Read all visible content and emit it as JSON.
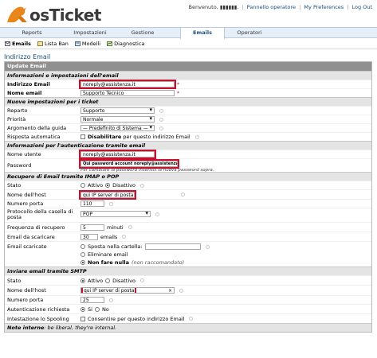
{
  "brand": {
    "name": "osTicket",
    "accent": "#e8861a",
    "link_color": "#184e81"
  },
  "toplinks": {
    "welcome": "Benvenuto, ",
    "user": "▮▮▮▮▮▮.",
    "panel": "Pannello operatore",
    "prefs": "My Preferences",
    "logout": "Log Out"
  },
  "tabs": [
    "Reports",
    "Impostazioni",
    "Gestione",
    "Emails",
    "Operatori"
  ],
  "subnav": [
    {
      "label": "Emails",
      "icon": "email-icon"
    },
    {
      "label": "Lista Ban",
      "icon": "ban-list-icon"
    },
    {
      "label": "Modelli",
      "icon": "template-icon"
    },
    {
      "label": "Diagnostica",
      "icon": "diagnostic-icon"
    }
  ],
  "page_title": "Indirizzo Email",
  "form": {
    "header": "Update Email",
    "s1": {
      "title": "Informazioni e impostazioni dell'email",
      "email_label": "Indirizzo Email",
      "email_value": "noreply@assistenza.it",
      "name_label": "Nome email",
      "name_value": "Supporto Tecnico",
      "req": "*"
    },
    "s2": {
      "title": "Nuove impostazioni per i ticket",
      "dept_label": "Reparto",
      "dept_value": "Supporto",
      "priority_label": "Priorità",
      "priority_value": "Normale",
      "topic_label": "Argomento della guida",
      "topic_value": "— Predefinito di Sistema —",
      "auto_label": "Risposta automatica",
      "auto_bold": "Disabilitare",
      "auto_rest": " per questo indirizzo Email"
    },
    "s3": {
      "title": "Informazioni per l'autenticazione tramite email",
      "user_label": "Nome utente",
      "user_value": "noreply@assistenza.it",
      "pass_label": "Password",
      "pass_value": "Qui password account noreply@assistenza.it",
      "pass_note": "Per cambiare la password inserisci la nuova password sopra."
    },
    "s4": {
      "title": "Recupero di Email tramite IMAP o POP",
      "status_label": "Stato",
      "status_on": "Attivo",
      "status_off": "Disattivo",
      "host_label": "Nome dell'host",
      "host_value": "qui IP server di posta",
      "port_label": "Numero porta",
      "port_value": "110",
      "proto_label": "Protocollo della casella di posta",
      "proto_value": "POP",
      "freq_label": "Frequenza di recupero",
      "freq_value": "5",
      "freq_unit": "minuti",
      "fetch_label": "Email da scaricare",
      "fetch_value": "30",
      "fetch_unit": "emails",
      "downloaded_label": "Email scaricate",
      "opt_move": "Sposta nella cartella:",
      "opt_delete": "Eliminare email",
      "opt_nothing": "Non fare nulla",
      "opt_nothing_note": "(non raccomandato)"
    },
    "s5": {
      "title": "inviare email tramite SMTP",
      "status_label": "Stato",
      "status_on": "Attivo",
      "status_off": "Disattivo",
      "host_label": "Nome dell'host",
      "host_value": "qui IP server di posta",
      "port_label": "Numero porta",
      "port_value": "25",
      "auth_label": "Autenticazione richiesta",
      "auth_yes": "Si",
      "auth_no": "No",
      "spool_label": "Intestazione lo Spooling",
      "spool_text": "Consentire per questo indirizzo Email"
    },
    "footer_bold": "Note interne",
    "footer_rest": ": be liberal, they're internal."
  }
}
